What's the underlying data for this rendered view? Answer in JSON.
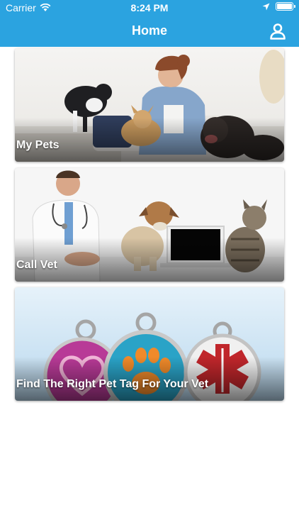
{
  "status_bar": {
    "carrier": "Carrier",
    "time": "8:24 PM",
    "icons": [
      "wifi-icon",
      "location-arrow-icon",
      "battery-icon"
    ]
  },
  "nav": {
    "title": "Home",
    "profile_icon": "user-profile-icon"
  },
  "colors": {
    "header_bg": "#2ba3e0",
    "header_text": "#ffffff",
    "page_bg": "#ffffff"
  },
  "cards": [
    {
      "label": "My Pets",
      "image": "woman-with-cat-and-dogs-photo"
    },
    {
      "label": "Call Vet",
      "image": "vet-dog-laptop-cat-photo"
    },
    {
      "label": "Find The Right Pet Tag For Your Vet",
      "image": "pet-id-tags-photo"
    }
  ]
}
